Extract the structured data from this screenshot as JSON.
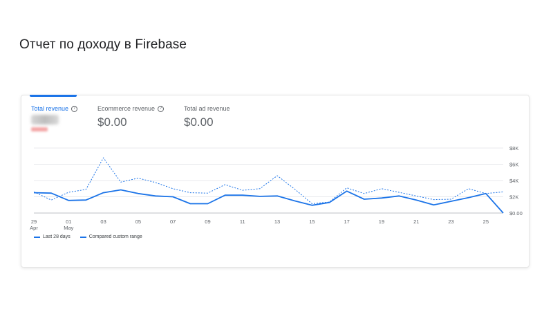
{
  "page_title": "Отчет по доходу в Firebase",
  "metrics": [
    {
      "label": "Total revenue",
      "value": "",
      "active": true,
      "help_icon": "help-circle-icon"
    },
    {
      "label": "Ecommerce revenue",
      "value": "$0.00",
      "active": false,
      "help_icon": "help-circle-icon"
    },
    {
      "label": "Total ad revenue",
      "value": "$0.00",
      "active": false
    }
  ],
  "colors": {
    "accent": "#1a73e8",
    "grid": "#e8eaed",
    "text_secondary": "#5f6368"
  },
  "legend": {
    "current": "Last 28 days",
    "compare": "Compared custom range"
  },
  "chart_data": {
    "type": "line",
    "x": [
      "29 Apr",
      "30 Apr",
      "01 May",
      "02 May",
      "03 May",
      "04 May",
      "05 May",
      "06 May",
      "07 May",
      "08 May",
      "09 May",
      "10 May",
      "11 May",
      "12 May",
      "13 May",
      "14 May",
      "15 May",
      "16 May",
      "17 May",
      "18 May",
      "19 May",
      "20 May",
      "21 May",
      "22 May",
      "23 May",
      "24 May",
      "25 May"
    ],
    "x_tick_labels": [
      {
        "index": 0,
        "line1": "29",
        "line2": "Apr"
      },
      {
        "index": 2,
        "line1": "01",
        "line2": "May"
      },
      {
        "index": 4,
        "line1": "03",
        "line2": ""
      },
      {
        "index": 6,
        "line1": "05",
        "line2": ""
      },
      {
        "index": 8,
        "line1": "07",
        "line2": ""
      },
      {
        "index": 10,
        "line1": "09",
        "line2": ""
      },
      {
        "index": 12,
        "line1": "11",
        "line2": ""
      },
      {
        "index": 14,
        "line1": "13",
        "line2": ""
      },
      {
        "index": 16,
        "line1": "15",
        "line2": ""
      },
      {
        "index": 18,
        "line1": "17",
        "line2": ""
      },
      {
        "index": 20,
        "line1": "19",
        "line2": ""
      },
      {
        "index": 22,
        "line1": "21",
        "line2": ""
      },
      {
        "index": 24,
        "line1": "23",
        "line2": ""
      },
      {
        "index": 26,
        "line1": "25",
        "line2": ""
      }
    ],
    "y_ticks": [
      0,
      2000,
      4000,
      6000,
      8000
    ],
    "y_tick_labels": [
      "$0.00",
      "$2K",
      "$4K",
      "$6K",
      "$8K"
    ],
    "ylim": [
      0,
      8000
    ],
    "grid": true,
    "y_axis_position": "right",
    "legend_position": "bottom-left",
    "series": [
      {
        "name": "Last 28 days",
        "style": "solid",
        "values": [
          2500,
          2450,
          1550,
          1600,
          2500,
          2850,
          2400,
          2100,
          2000,
          1150,
          1150,
          2200,
          2200,
          2050,
          2100,
          1500,
          950,
          1300,
          2700,
          1700,
          1850,
          2100,
          1600,
          1000,
          1450,
          1900,
          2400,
          0
        ]
      },
      {
        "name": "Compared custom range",
        "style": "dashed",
        "values": [
          2600,
          1600,
          2550,
          2900,
          6800,
          3800,
          4300,
          3750,
          3000,
          2500,
          2450,
          3500,
          2800,
          3000,
          4600,
          2950,
          1150,
          1350,
          3100,
          2400,
          3000,
          2550,
          2100,
          1650,
          1700,
          3000,
          2400,
          2600
        ]
      }
    ]
  }
}
